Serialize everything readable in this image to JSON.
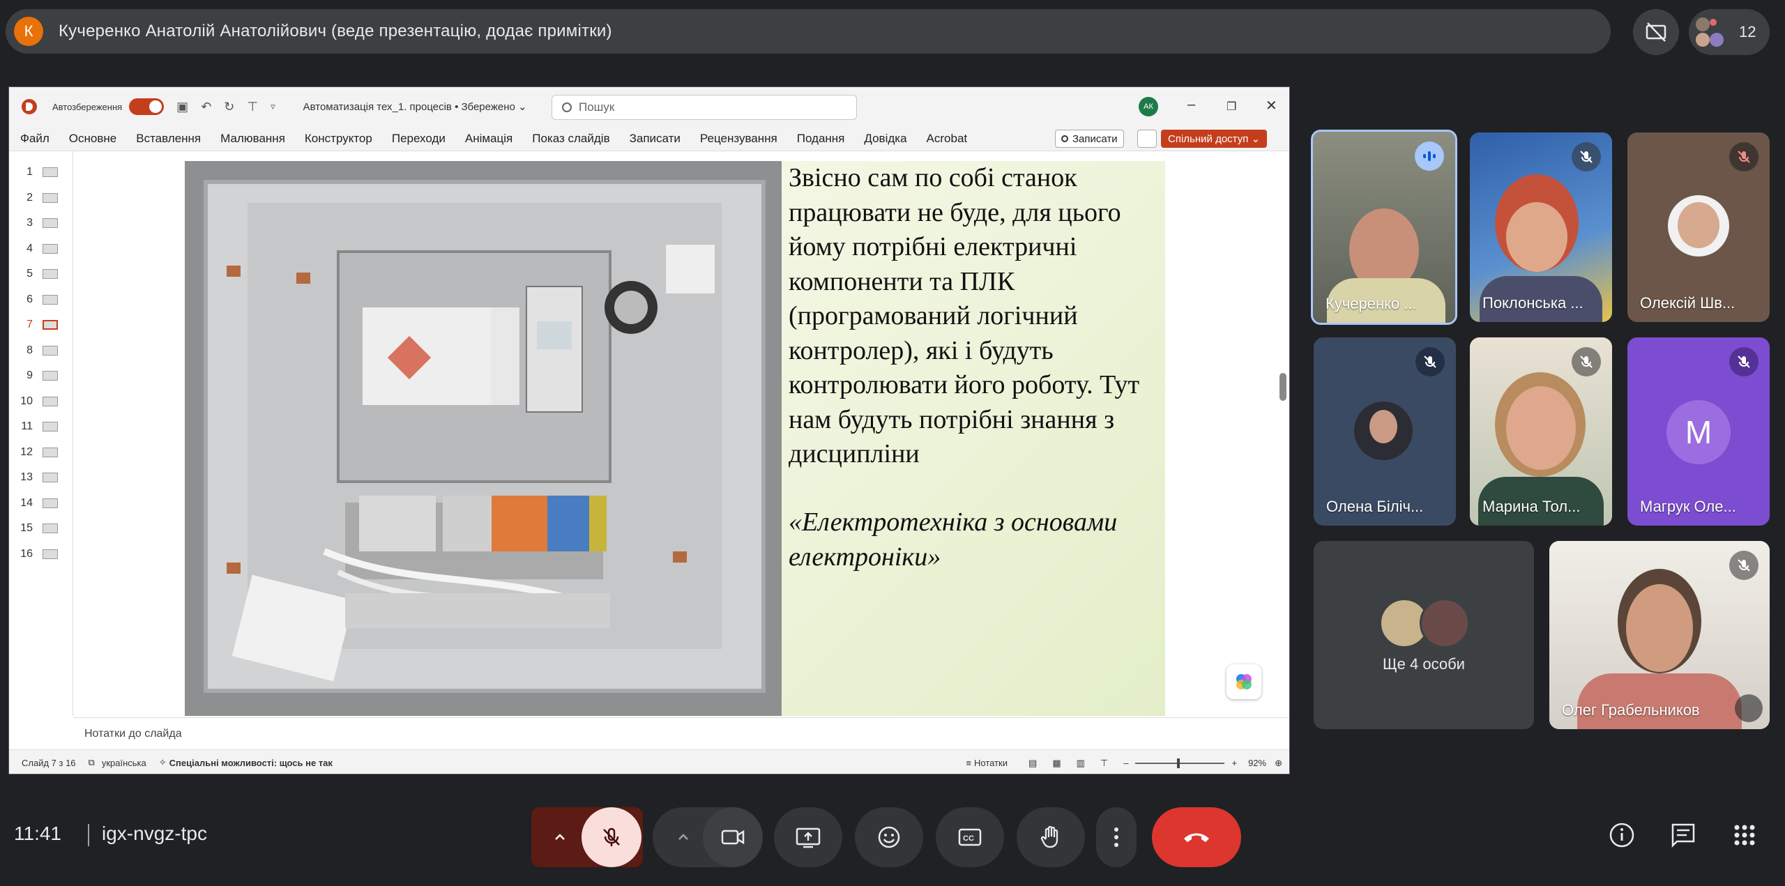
{
  "presenter": {
    "initial": "К",
    "title": "Кучеренко Анатолій Анатолійович (веде презентацію, додає примітки)"
  },
  "people_count": "12",
  "ppt": {
    "autosave_label": "Автозбереження",
    "doc_title": "Автоматизація тех_1. процесів • Збережено ⌄",
    "search_placeholder": "Пошук",
    "avatar_initials": "АК",
    "menu": [
      "Файл",
      "Основне",
      "Вставлення",
      "Малювання",
      "Конструктор",
      "Переходи",
      "Анімація",
      "Показ слайдів",
      "Записати",
      "Рецензування",
      "Подання",
      "Довідка",
      "Acrobat"
    ],
    "record_label": "Записати",
    "share_label": "Спільний доступ ⌄",
    "thumbnails": [
      "1",
      "2",
      "3",
      "4",
      "5",
      "6",
      "7",
      "8",
      "9",
      "10",
      "11",
      "12",
      "13",
      "14",
      "15",
      "16"
    ],
    "active_slide": 7,
    "slide_text": "Звісно сам по собі станок працювати не буде, для цього йому потрібні електричні компоненти та ПЛК (програмований логічний контролер), які і будуть контролювати його роботу. Тут нам будуть потрібні знання з дисципліни",
    "slide_quote": "«Електротехніка з основами електроніки»",
    "notes_placeholder": "Нотатки до слайда",
    "status": {
      "slide_info": "Слайд 7 з 16",
      "language": "українська",
      "accessibility": "Спеціальні можливості: щось не так",
      "notes_btn": "Нотатки",
      "zoom": "92%"
    }
  },
  "participants": [
    {
      "name": "Кучеренко ...",
      "status": "speaking"
    },
    {
      "name": "Поклонська ...",
      "status": "muted"
    },
    {
      "name": "Олексій Шв...",
      "status": "muted"
    },
    {
      "name": "Олена Біліч...",
      "status": "muted"
    },
    {
      "name": "Марина Тол...",
      "status": "muted"
    },
    {
      "name": "Магрук Оле...",
      "status": "muted",
      "initial": "M"
    },
    {
      "name": "Ще 4 особи",
      "status": "group"
    },
    {
      "name": "Олег Грабельников",
      "status": "muted"
    }
  ],
  "meeting": {
    "time": "11:41",
    "code": "igx-nvgz-tpc"
  },
  "colors": {
    "background": "#202124",
    "accent_red": "#ea4335",
    "ppt_brand": "#c43e1c",
    "speaking_border": "#a8c7fa"
  }
}
